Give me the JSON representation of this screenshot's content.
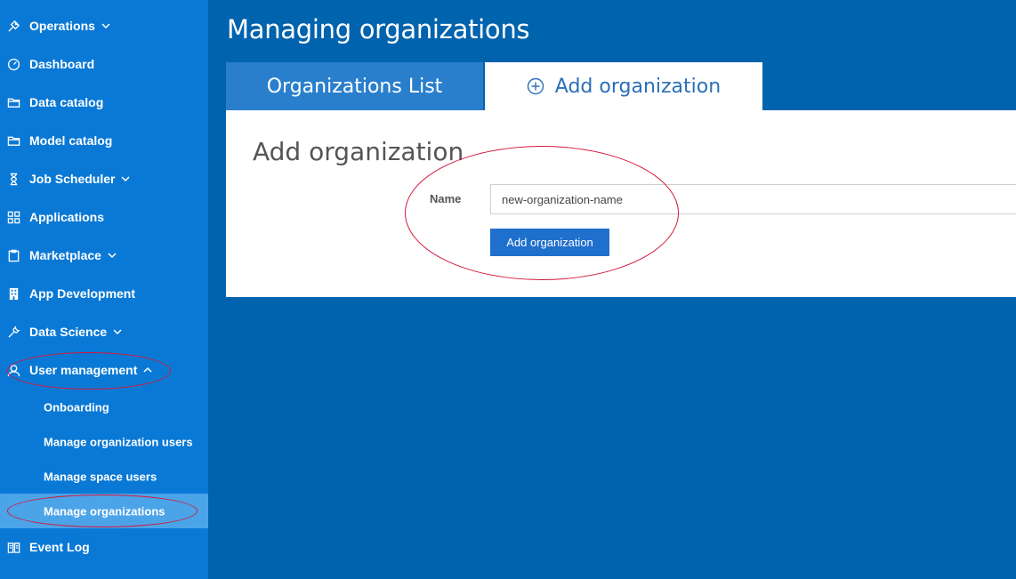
{
  "sidebar": {
    "items": [
      {
        "label": "Operations",
        "icon": "operations-icon",
        "expandable": true
      },
      {
        "label": "Dashboard",
        "icon": "dashboard-icon"
      },
      {
        "label": "Data catalog",
        "icon": "folder-icon"
      },
      {
        "label": "Model catalog",
        "icon": "folder-icon"
      },
      {
        "label": "Job Scheduler",
        "icon": "hourglass-icon",
        "expandable": true
      },
      {
        "label": "Applications",
        "icon": "grid-icon"
      },
      {
        "label": "Marketplace",
        "icon": "clipboard-icon",
        "expandable": true
      },
      {
        "label": "App Development",
        "icon": "building-icon"
      },
      {
        "label": "Data Science",
        "icon": "wrench-icon",
        "expandable": true
      },
      {
        "label": "User management",
        "icon": "user-icon",
        "expanded": true
      }
    ],
    "sub_items": [
      {
        "label": "Onboarding"
      },
      {
        "label": "Manage organization users"
      },
      {
        "label": "Manage space users"
      },
      {
        "label": "Manage organizations",
        "active": true
      }
    ],
    "footer_item": {
      "label": "Event Log",
      "icon": "book-icon"
    }
  },
  "main": {
    "title": "Managing organizations",
    "tabs": [
      {
        "label": "Organizations List",
        "active": false
      },
      {
        "label": "Add organization",
        "active": true,
        "icon": "plus-circle-icon"
      }
    ],
    "form": {
      "heading": "Add organization",
      "name_label": "Name",
      "name_value": "new-organization-name",
      "submit_label": "Add organization"
    }
  },
  "colors": {
    "background": "#0063ad",
    "sidebar": "#0a79d6",
    "active_sub_item": "#4ba4e8",
    "accent_button": "#1f6fcc",
    "annotation": "#d4173a"
  }
}
